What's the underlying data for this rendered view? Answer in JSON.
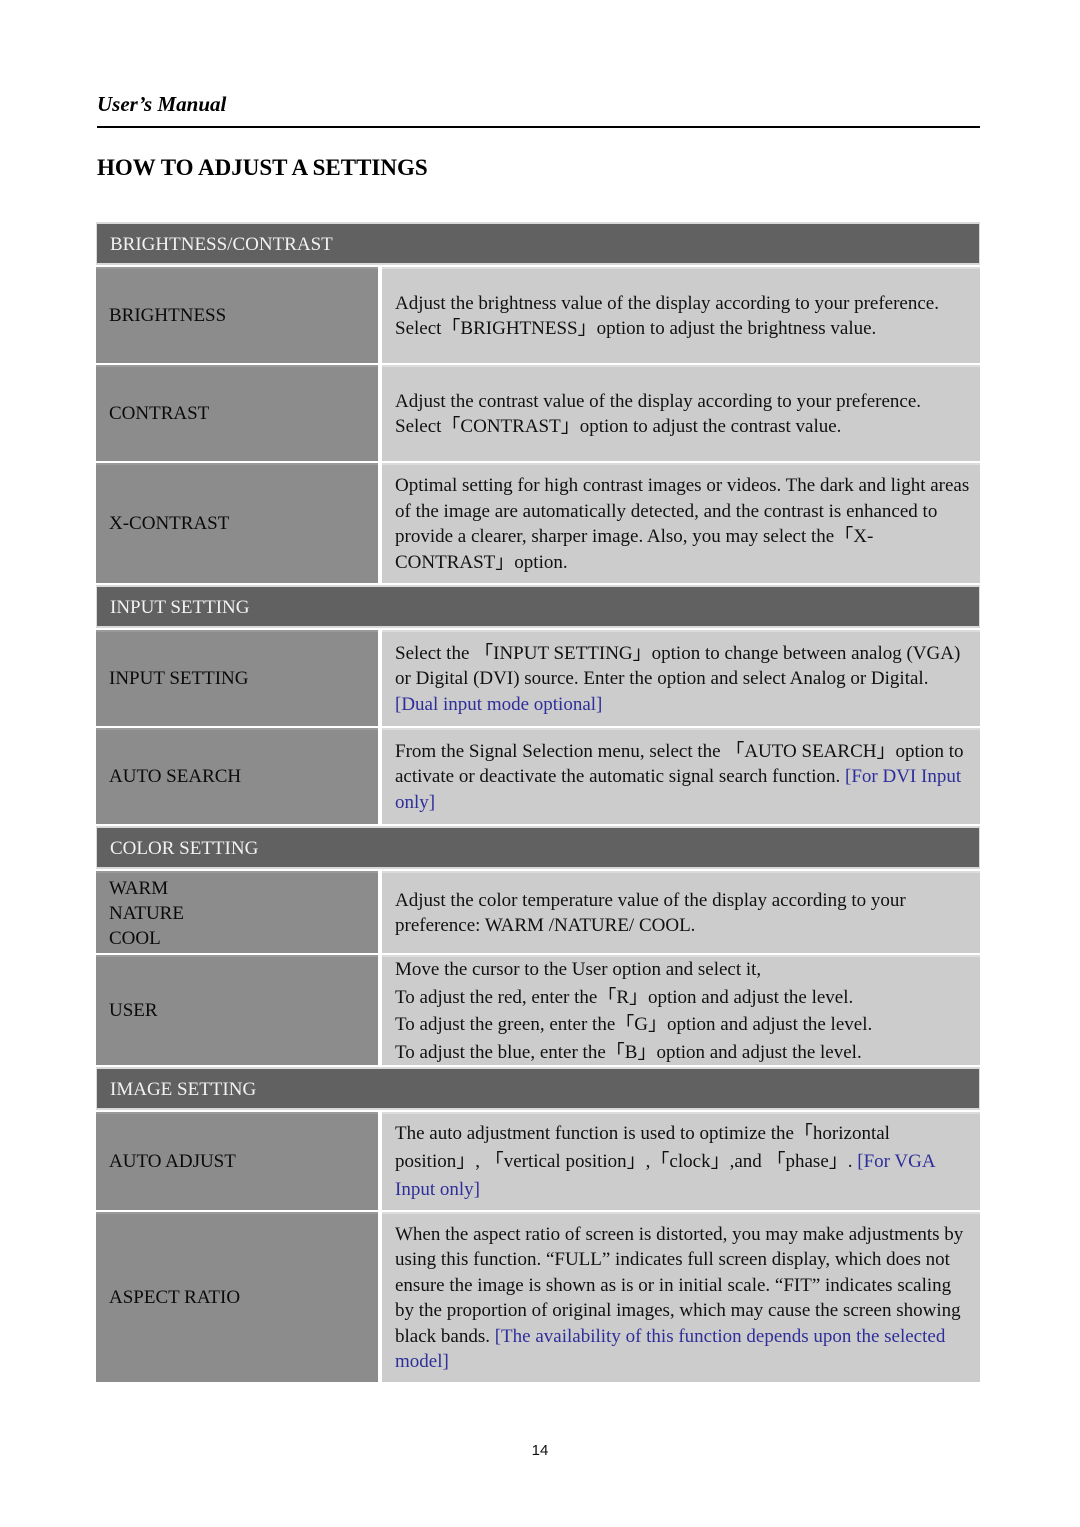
{
  "header": {
    "running_head": "User’s Manual",
    "title": "HOW TO ADJUST A SETTINGS"
  },
  "colors": {
    "section_header_bg": "#616161",
    "name_cell_bg": "#8c8c8c",
    "desc_cell_bg": "#cccccc",
    "note_text": "#2e2e9a"
  },
  "sections": [
    {
      "title": "BRIGHTNESS/CONTRAST",
      "rows": [
        {
          "name": "BRIGHTNESS",
          "desc": "Adjust the brightness value of the display according to your preference. Select「BRIGHTNESS」option to adjust the brightness value.",
          "note": ""
        },
        {
          "name": "CONTRAST",
          "desc": "Adjust the contrast value of the display according to your preference. Select「CONTRAST」option to adjust the contrast value.",
          "note": ""
        },
        {
          "name": "X-CONTRAST",
          "desc": "Optimal setting for high contrast images or videos. The dark and light areas of the image are automatically detected, and the contrast is enhanced to provide a clearer, sharper image. Also, you may select the「X-CONTRAST」option.",
          "note": ""
        }
      ]
    },
    {
      "title": "INPUT SETTING",
      "rows": [
        {
          "name": "INPUT SETTING",
          "desc": "Select the 「INPUT SETTING」option to change between analog (VGA) or Digital (DVI) source. Enter the option and select Analog or Digital.",
          "note": "[Dual input mode optional]"
        },
        {
          "name": "AUTO SEARCH",
          "desc": "From the Signal Selection menu, select the 「AUTO SEARCH」option to activate or deactivate the automatic signal search function.",
          "note": "[For DVI Input only]"
        }
      ]
    },
    {
      "title": "COLOR SETTING",
      "rows": [
        {
          "names": [
            "WARM",
            "NATURE",
            "COOL"
          ],
          "desc": "Adjust the color temperature value of the display according to your preference: WARM /NATURE/ COOL.",
          "note": ""
        },
        {
          "name": "USER",
          "lines": [
            "Move the cursor to the User option and select it,",
            "To adjust the red, enter the「R」option and adjust the level.",
            "To adjust the green, enter the「G」option and adjust the level.",
            "To adjust the blue, enter the「B」option and adjust the level."
          ]
        }
      ]
    },
    {
      "title": "IMAGE SETTING",
      "rows": [
        {
          "name": "AUTO ADJUST",
          "desc": "The auto adjustment function is used to optimize the「horizontal position」, 「vertical position」,「clock」,and 「phase」.",
          "note": "[For VGA Input only]"
        },
        {
          "name": "ASPECT RATIO",
          "desc": "When the aspect ratio of screen is distorted, you may make adjustments by using this function. “FULL” indicates full screen display, which does not ensure the image is shown as is or in initial scale. “FIT” indicates scaling by the proportion of original images, which may cause the screen showing black bands.",
          "note": "[The availability of this function depends upon the selected model]"
        }
      ]
    }
  ],
  "footer": {
    "page_number": "14"
  }
}
